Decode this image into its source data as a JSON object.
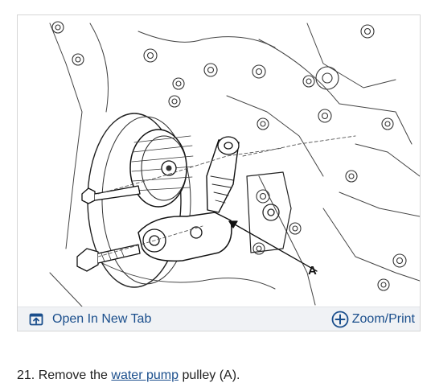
{
  "figure": {
    "callout_label": "A",
    "toolbar": {
      "open_tab_label": "Open In New Tab",
      "open_tab_icon": "open-in-new-tab-icon",
      "zoom_label": "Zoom/Print",
      "zoom_icon": "zoom-plus-circle-icon"
    }
  },
  "instruction": {
    "step_prefix": "21. Remove the ",
    "link_text": "water pump",
    "step_suffix": " pulley (A)."
  },
  "colors": {
    "link": "#1a4e8c",
    "toolbar_bg": "#f0f2f5",
    "border": "#d6d6d6",
    "text": "#222222"
  }
}
